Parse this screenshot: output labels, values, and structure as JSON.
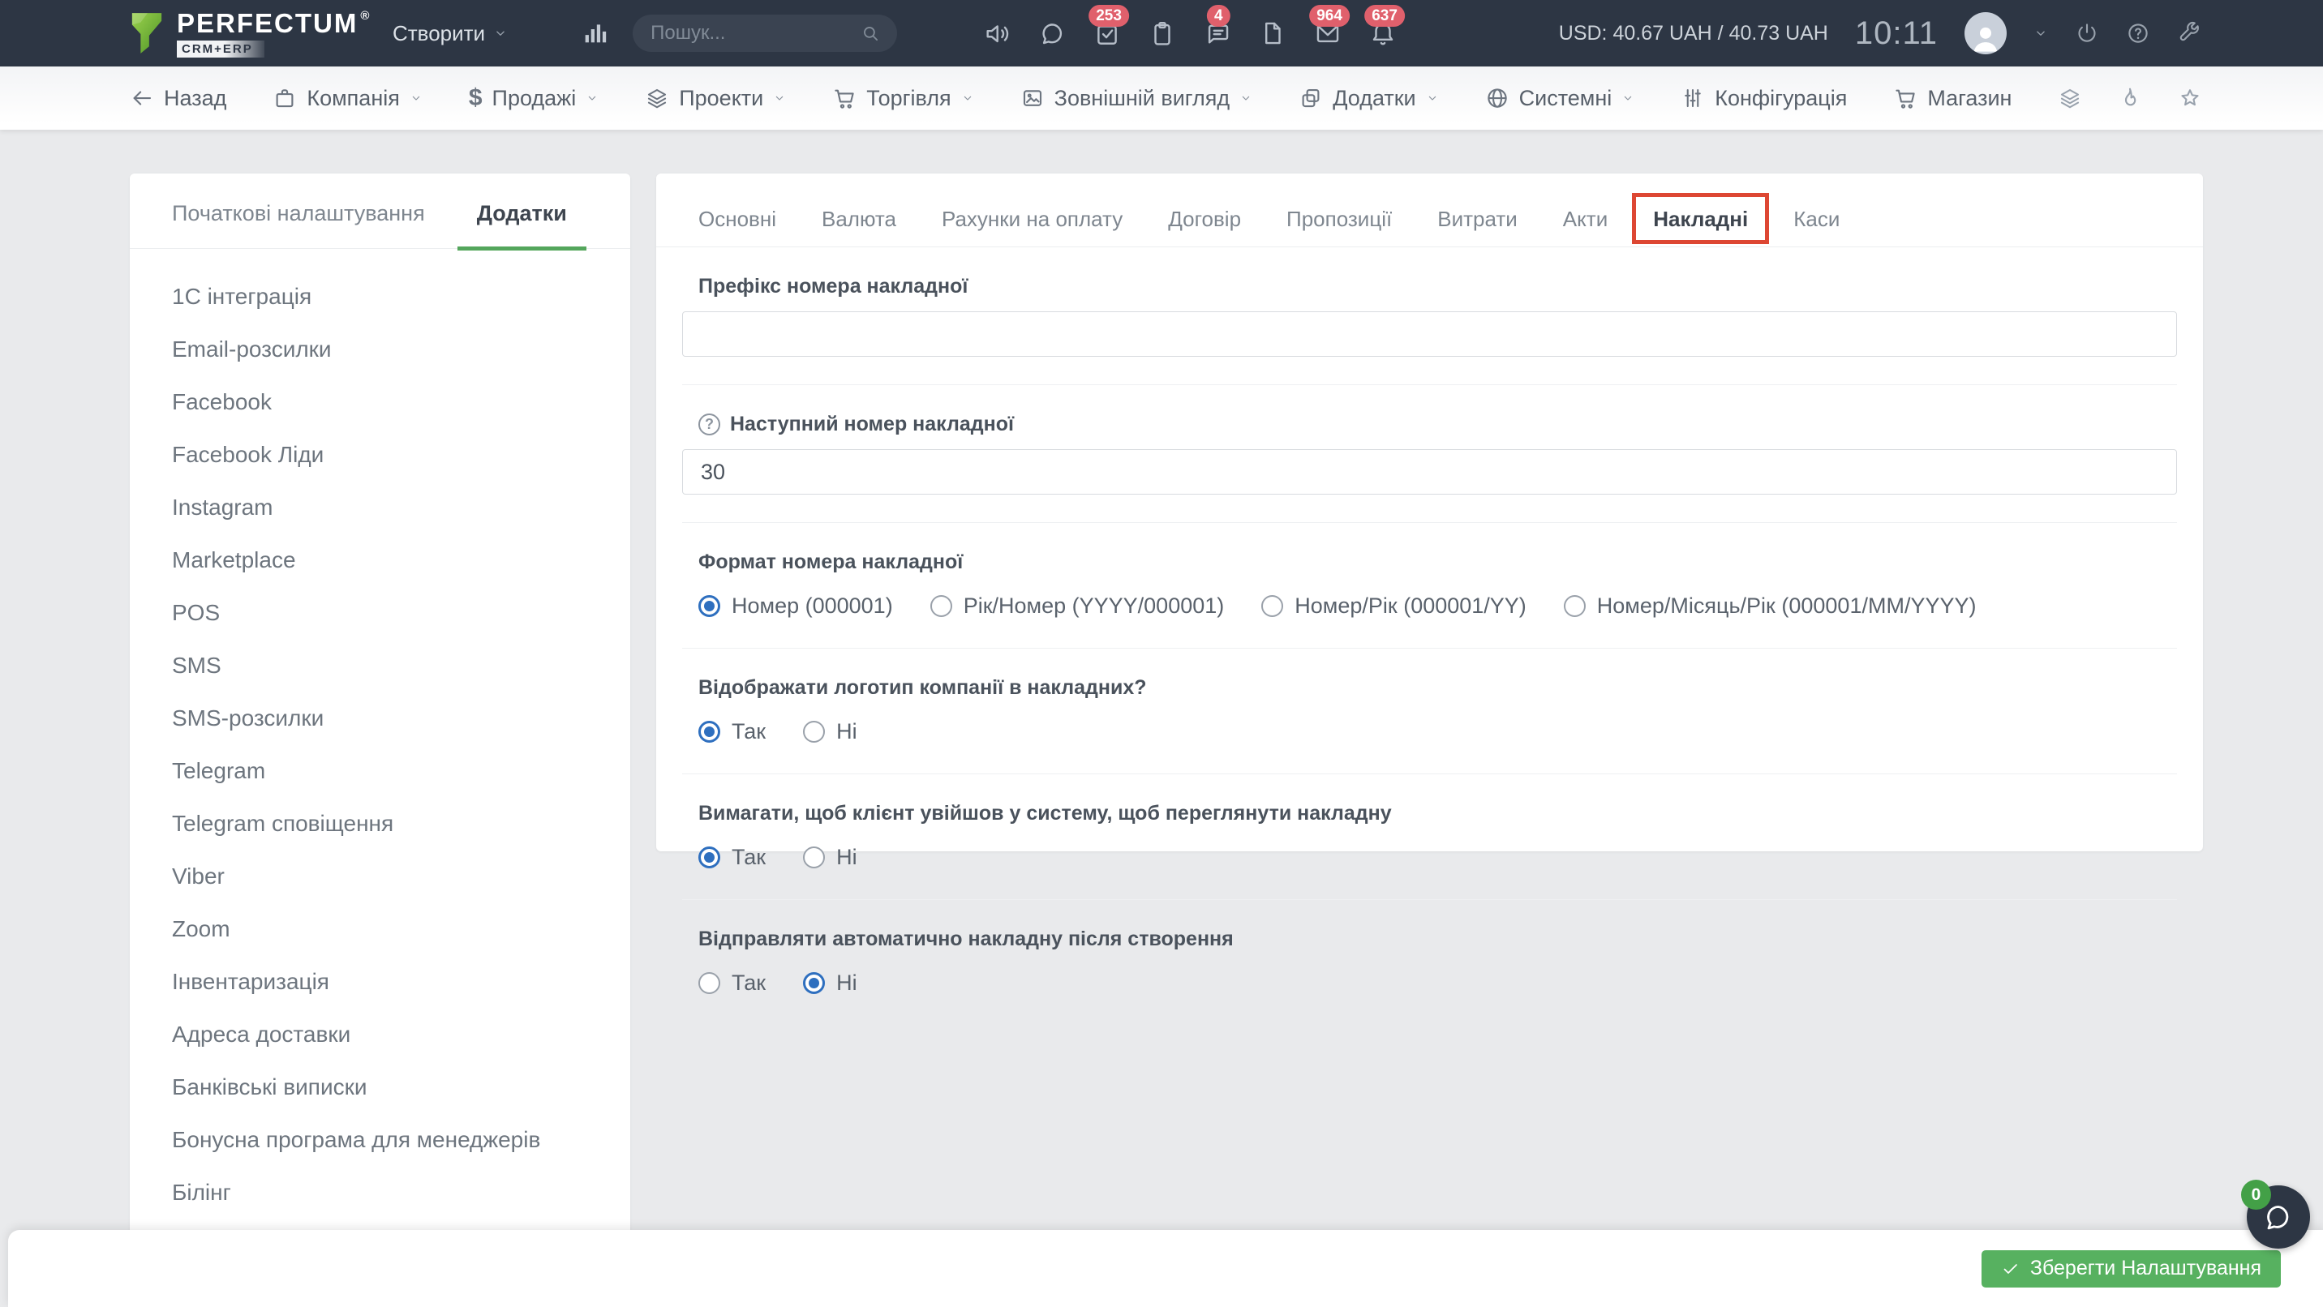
{
  "header": {
    "brand": "PERFECTUM",
    "registered": "®",
    "product": "CRM+ERP",
    "create_label": "Створити",
    "search_placeholder": "Пошук...",
    "badges": {
      "tasks": "253",
      "comments": "4",
      "mail": "964",
      "alerts": "637"
    },
    "currency": "USD: 40.67 UAH / 40.73 UAH",
    "time": "10:11"
  },
  "nav": {
    "back": "Назад",
    "dollar_glyph": "$",
    "items": [
      {
        "label": "Компанія"
      },
      {
        "label": "Продажі"
      },
      {
        "label": "Проекти"
      },
      {
        "label": "Торгівля"
      },
      {
        "label": "Зовнішній вигляд"
      },
      {
        "label": "Додатки"
      },
      {
        "label": "Системні"
      },
      {
        "label": "Конфігурація"
      },
      {
        "label": "Магазин"
      }
    ]
  },
  "sidebar": {
    "tabs": [
      {
        "label": "Початкові налаштування",
        "active": false
      },
      {
        "label": "Додатки",
        "active": true
      }
    ],
    "items": [
      "1С інтеграція",
      "Email-розсилки",
      "Facebook",
      "Facebook Ліди",
      "Instagram",
      "Marketplace",
      "POS",
      "SMS",
      "SMS-розсилки",
      "Telegram",
      "Telegram сповіщення",
      "Viber",
      "Zoom",
      "Інвентаризація",
      "Адреса доставки",
      "Банківські виписки",
      "Бонусна програма для менеджерів",
      "Білінг"
    ]
  },
  "settings": {
    "tabs": [
      {
        "label": "Основні",
        "active": false,
        "highlighted": false
      },
      {
        "label": "Валюта",
        "active": false,
        "highlighted": false
      },
      {
        "label": "Рахунки на оплату",
        "active": false,
        "highlighted": false
      },
      {
        "label": "Договір",
        "active": false,
        "highlighted": false
      },
      {
        "label": "Пропозиції",
        "active": false,
        "highlighted": false
      },
      {
        "label": "Витрати",
        "active": false,
        "highlighted": false
      },
      {
        "label": "Акти",
        "active": false,
        "highlighted": false
      },
      {
        "label": "Накладні",
        "active": true,
        "highlighted": true
      },
      {
        "label": "Каси",
        "active": false,
        "highlighted": false
      }
    ],
    "prefix": {
      "label": "Префікс номера накладної",
      "value": ""
    },
    "next_number": {
      "label": "Наступний номер накладної",
      "help_glyph": "?",
      "value": "30"
    },
    "format": {
      "label": "Формат номера накладної",
      "options": [
        {
          "label": "Номер (000001)",
          "selected": true
        },
        {
          "label": "Рік/Номер (YYYY/000001)",
          "selected": false
        },
        {
          "label": "Номер/Рік (000001/YY)",
          "selected": false
        },
        {
          "label": "Номер/Місяць/Рік (000001/MM/YYYY)",
          "selected": false
        }
      ]
    },
    "questions": [
      {
        "label": "Відображати логотип компанії в накладних?",
        "options": [
          {
            "label": "Так",
            "selected": true
          },
          {
            "label": "Ні",
            "selected": false
          }
        ]
      },
      {
        "label": "Вимагати, щоб клієнт увійшов у систему, щоб переглянути накладну",
        "options": [
          {
            "label": "Так",
            "selected": true
          },
          {
            "label": "Ні",
            "selected": false
          }
        ]
      },
      {
        "label": "Відправляти автоматично накладну після створення",
        "options": [
          {
            "label": "Так",
            "selected": false
          },
          {
            "label": "Ні",
            "selected": true
          }
        ]
      }
    ]
  },
  "footer": {
    "save_label": "Зберегти Налаштування"
  },
  "chat": {
    "badge": "0"
  },
  "colors": {
    "header_bg": "#2d3644",
    "brand_green": "#76b82a",
    "accent_green": "#54a65c",
    "save_green": "#57b160",
    "badge_red": "#e0606c",
    "radio_blue": "#2e6fbf",
    "highlight_red": "#dd4733"
  }
}
